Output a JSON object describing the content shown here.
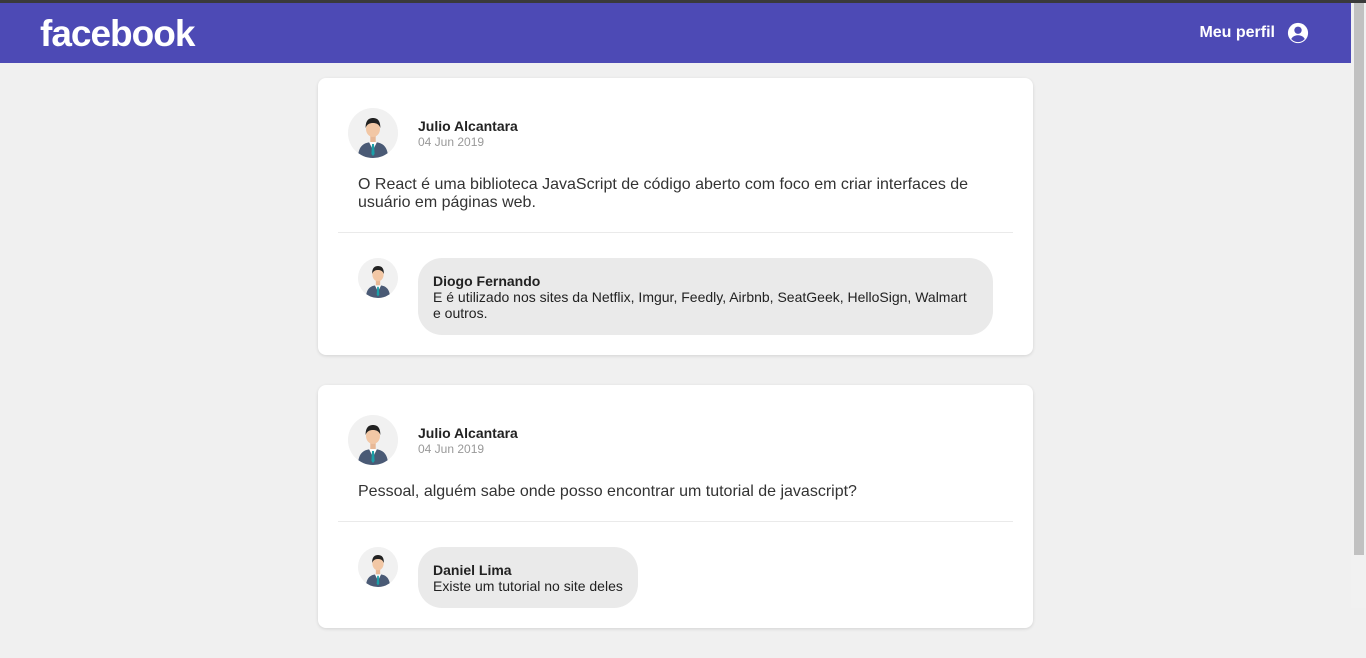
{
  "header": {
    "logo": "facebook",
    "profile_label": "Meu perfil",
    "profile_icon": "user-circle-icon",
    "background": "#4d4ab5"
  },
  "posts": [
    {
      "author": "Julio Alcantara",
      "date": "04 Jun 2019",
      "content": "O React é uma biblioteca JavaScript de código aberto com foco em criar interfaces de usuário em páginas web.",
      "comments": [
        {
          "author": "Diogo Fernando",
          "text": "E é utilizado nos sites da Netflix, Imgur, Feedly, Airbnb, SeatGeek, HelloSign, Walmart e outros."
        }
      ]
    },
    {
      "author": "Julio Alcantara",
      "date": "04 Jun 2019",
      "content": "Pessoal, alguém sabe onde posso encontrar um tutorial de javascript?",
      "comments": [
        {
          "author": "Daniel Lima",
          "text": "Existe um tutorial no site deles"
        }
      ]
    }
  ]
}
